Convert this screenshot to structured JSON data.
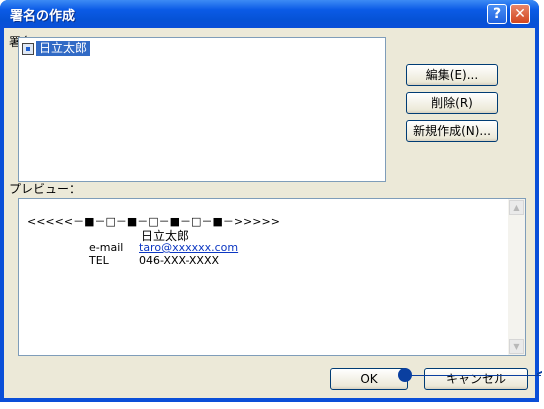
{
  "window": {
    "title": "署名の作成"
  },
  "title_buttons": {
    "help": "?",
    "close": "✕"
  },
  "signature_section": {
    "label": "署名：",
    "items": [
      {
        "label": "日立太郎",
        "icon": "signature-icon",
        "selected": true
      }
    ]
  },
  "buttons": {
    "edit": "編集(E)...",
    "delete": "削除(R)",
    "new": "新規作成(N)...",
    "ok": "OK",
    "cancel": "キャンセル"
  },
  "preview": {
    "label": "プレビュー：",
    "line1": "<<<<<－■－□－■－□－■－□－■－>>>>>",
    "name": "日立太郎",
    "email_label": "e-mail",
    "email": "taro@xxxxxx.com",
    "tel_label": "TEL",
    "tel": "046-XXX-XXXX"
  },
  "colors": {
    "titlebar": "#0a4fd8",
    "dialog_bg": "#ece9d8",
    "selection": "#316ac5",
    "callout": "#0a3fa0"
  }
}
